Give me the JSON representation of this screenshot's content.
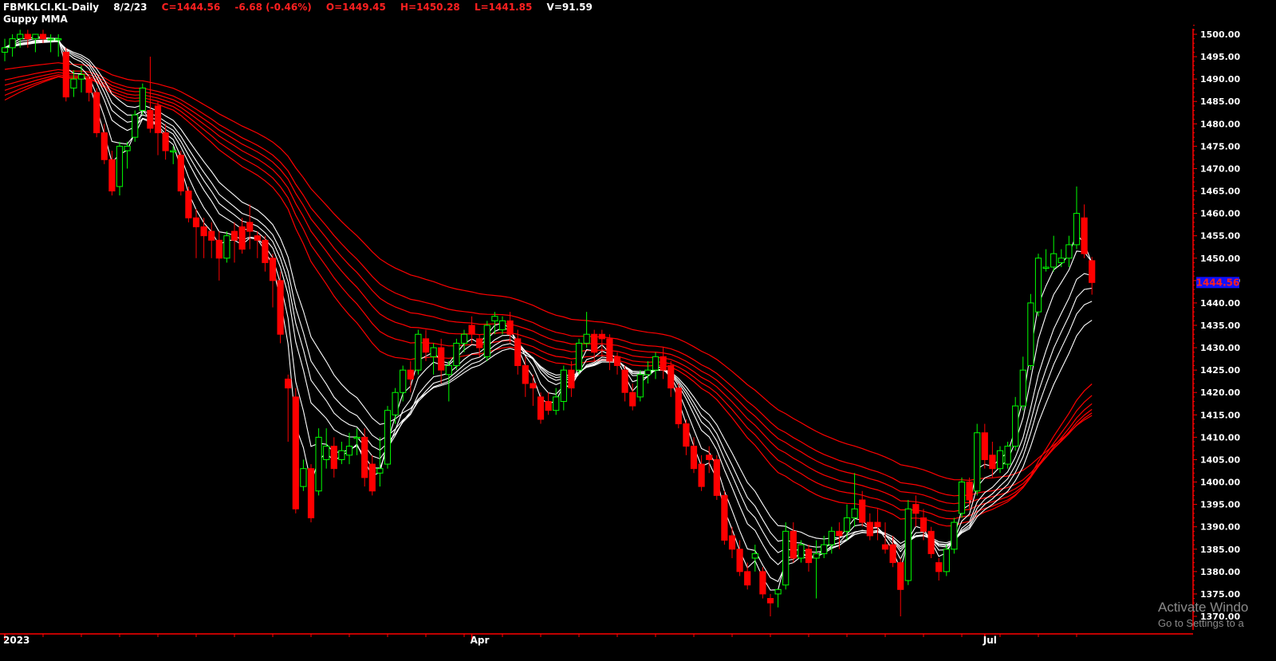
{
  "header": {
    "symbol": "FBMKLCI.KL",
    "period": "-Daily",
    "date": "8/2/23",
    "close": "C=1444.56",
    "change": "-6.68 (-0.46%)",
    "open": "O=1449.45",
    "high": "H=1450.28",
    "low": "L=1441.85",
    "volume": "V=91.59"
  },
  "indicator": {
    "label": "Guppy MMA"
  },
  "price_tag": {
    "text": "1444.56",
    "value": 1444.56,
    "bg": "#1010ff",
    "color": "#ff2020"
  },
  "watermark": {
    "line1": "Activate Windo",
    "line2": "Go to Settings to a"
  },
  "colors": {
    "background": "#000000",
    "bull": "#00ff00",
    "bear": "#ff0000",
    "short_mma": "#ffffff",
    "long_mma": "#ff0000",
    "axis": "#ff0000",
    "tick_label": "#ffffff"
  },
  "chart_data": {
    "type": "candlestick",
    "title": "FBMKLCI.KL -Daily 8/2/23",
    "ylim": [
      1369,
      1503
    ],
    "y_ticks": [
      1370,
      1375,
      1380,
      1385,
      1390,
      1395,
      1400,
      1405,
      1410,
      1415,
      1420,
      1425,
      1430,
      1435,
      1440,
      1445,
      1450,
      1455,
      1460,
      1465,
      1470,
      1475,
      1480,
      1485,
      1490,
      1495,
      1500
    ],
    "x_labels": [
      {
        "label": "2023",
        "index": 0
      },
      {
        "label": "Apr",
        "index": 61
      },
      {
        "label": "Jul",
        "index": 128
      }
    ],
    "candles": [
      [
        1496,
        1499,
        1494,
        1497
      ],
      [
        1497,
        1500,
        1495,
        1499
      ],
      [
        1499,
        1501,
        1497,
        1500
      ],
      [
        1500,
        1501,
        1497,
        1499
      ],
      [
        1499,
        1500,
        1496,
        1500
      ],
      [
        1500,
        1501,
        1498,
        1499
      ],
      [
        1499,
        1500,
        1496,
        1499
      ],
      [
        1499,
        1500,
        1495,
        1499
      ],
      [
        1496,
        1497,
        1485,
        1486
      ],
      [
        1488,
        1492,
        1486,
        1490
      ],
      [
        1490,
        1493,
        1487,
        1491
      ],
      [
        1490,
        1491,
        1485,
        1487
      ],
      [
        1487,
        1488,
        1477,
        1478
      ],
      [
        1478,
        1480,
        1471,
        1472
      ],
      [
        1472,
        1474,
        1464,
        1465
      ],
      [
        1466,
        1476,
        1464,
        1475
      ],
      [
        1474,
        1476,
        1470,
        1475
      ],
      [
        1477,
        1483,
        1476,
        1482
      ],
      [
        1483,
        1489,
        1482,
        1488
      ],
      [
        1483,
        1495,
        1478,
        1479
      ],
      [
        1484,
        1485,
        1473,
        1478
      ],
      [
        1478,
        1480,
        1472,
        1474
      ],
      [
        1474,
        1475,
        1471,
        1474
      ],
      [
        1473,
        1474,
        1464,
        1465
      ],
      [
        1465,
        1466,
        1458,
        1459
      ],
      [
        1459,
        1461,
        1450,
        1457
      ],
      [
        1457,
        1459,
        1450,
        1455
      ],
      [
        1456,
        1458,
        1450,
        1454
      ],
      [
        1454,
        1456,
        1445,
        1450
      ],
      [
        1450,
        1456,
        1449,
        1455
      ],
      [
        1456,
        1458,
        1449,
        1454
      ],
      [
        1457,
        1459,
        1451,
        1452
      ],
      [
        1458,
        1462,
        1452,
        1456
      ],
      [
        1455,
        1456,
        1450,
        1454
      ],
      [
        1454,
        1455,
        1447,
        1449
      ],
      [
        1450,
        1451,
        1439,
        1445
      ],
      [
        1445,
        1447,
        1431,
        1433
      ],
      [
        1423,
        1424,
        1409,
        1421
      ],
      [
        1419,
        1421,
        1393,
        1394
      ],
      [
        1399,
        1405,
        1398,
        1403
      ],
      [
        1403,
        1404,
        1391,
        1392
      ],
      [
        1398,
        1412,
        1397,
        1410
      ],
      [
        1405,
        1412,
        1403,
        1408
      ],
      [
        1408,
        1410,
        1401,
        1403
      ],
      [
        1405,
        1409,
        1404,
        1407
      ],
      [
        1406,
        1411,
        1404,
        1408
      ],
      [
        1410,
        1412,
        1406,
        1410
      ],
      [
        1410,
        1412,
        1399,
        1401
      ],
      [
        1404,
        1406,
        1397,
        1398
      ],
      [
        1402,
        1410,
        1399,
        1403
      ],
      [
        1404,
        1417,
        1403,
        1416
      ],
      [
        1415,
        1421,
        1413,
        1420
      ],
      [
        1420,
        1426,
        1418,
        1425
      ],
      [
        1425,
        1427,
        1420,
        1423
      ],
      [
        1425,
        1434,
        1424,
        1433
      ],
      [
        1432,
        1434,
        1427,
        1429
      ],
      [
        1428,
        1431,
        1424,
        1430
      ],
      [
        1430,
        1432,
        1422,
        1425
      ],
      [
        1424,
        1427,
        1418,
        1426
      ],
      [
        1426,
        1432,
        1425,
        1431
      ],
      [
        1431,
        1434,
        1429,
        1433
      ],
      [
        1435,
        1437,
        1431,
        1433
      ],
      [
        1432,
        1433,
        1428,
        1430
      ],
      [
        1428,
        1436,
        1427,
        1435
      ],
      [
        1436,
        1438,
        1433,
        1437
      ],
      [
        1434,
        1437,
        1433,
        1436
      ],
      [
        1436,
        1438,
        1431,
        1433
      ],
      [
        1432,
        1434,
        1424,
        1426
      ],
      [
        1426,
        1428,
        1419,
        1422
      ],
      [
        1422,
        1424,
        1417,
        1421
      ],
      [
        1419,
        1420,
        1413,
        1414
      ],
      [
        1418,
        1420,
        1415,
        1416
      ],
      [
        1416,
        1421,
        1415,
        1419
      ],
      [
        1418,
        1426,
        1416,
        1425
      ],
      [
        1425,
        1427,
        1419,
        1421
      ],
      [
        1425,
        1432,
        1424,
        1431
      ],
      [
        1431,
        1438,
        1430,
        1433
      ],
      [
        1433,
        1434,
        1427,
        1429
      ],
      [
        1433,
        1434,
        1428,
        1432
      ],
      [
        1432,
        1433,
        1425,
        1427
      ],
      [
        1428,
        1429,
        1424,
        1426
      ],
      [
        1425,
        1426,
        1418,
        1420
      ],
      [
        1420,
        1422,
        1416,
        1417
      ],
      [
        1419,
        1425,
        1418,
        1424
      ],
      [
        1424,
        1427,
        1422,
        1425
      ],
      [
        1425,
        1429,
        1423,
        1428
      ],
      [
        1428,
        1430,
        1423,
        1425
      ],
      [
        1426,
        1427,
        1419,
        1421
      ],
      [
        1421,
        1422,
        1412,
        1413
      ],
      [
        1413,
        1414,
        1406,
        1408
      ],
      [
        1408,
        1410,
        1402,
        1403
      ],
      [
        1404,
        1406,
        1398,
        1399
      ],
      [
        1406,
        1408,
        1402,
        1405
      ],
      [
        1405,
        1406,
        1396,
        1397
      ],
      [
        1397,
        1398,
        1386,
        1387
      ],
      [
        1388,
        1390,
        1383,
        1385
      ],
      [
        1385,
        1387,
        1379,
        1380
      ],
      [
        1380,
        1382,
        1376,
        1377
      ],
      [
        1383,
        1386,
        1380,
        1384
      ],
      [
        1380,
        1381,
        1374,
        1375
      ],
      [
        1374,
        1375,
        1370,
        1373
      ],
      [
        1375,
        1376,
        1372,
        1376
      ],
      [
        1377,
        1391,
        1376,
        1389
      ],
      [
        1389,
        1391,
        1382,
        1383
      ],
      [
        1383,
        1387,
        1382,
        1386
      ],
      [
        1385,
        1386,
        1380,
        1382
      ],
      [
        1383,
        1387,
        1374,
        1384
      ],
      [
        1384,
        1388,
        1383,
        1386
      ],
      [
        1386,
        1390,
        1384,
        1389
      ],
      [
        1389,
        1391,
        1385,
        1388
      ],
      [
        1389,
        1395,
        1387,
        1392
      ],
      [
        1392,
        1402,
        1390,
        1394
      ],
      [
        1396,
        1398,
        1390,
        1391
      ],
      [
        1391,
        1393,
        1387,
        1388
      ],
      [
        1391,
        1394,
        1387,
        1390
      ],
      [
        1386,
        1391,
        1384,
        1385
      ],
      [
        1386,
        1388,
        1381,
        1382
      ],
      [
        1382,
        1383,
        1370,
        1376
      ],
      [
        1378,
        1396,
        1377,
        1394
      ],
      [
        1395,
        1397,
        1390,
        1393
      ],
      [
        1392,
        1394,
        1387,
        1389
      ],
      [
        1389,
        1390,
        1383,
        1384
      ],
      [
        1382,
        1383,
        1378,
        1380
      ],
      [
        1380,
        1386,
        1379,
        1385
      ],
      [
        1385,
        1392,
        1384,
        1391
      ],
      [
        1393,
        1401,
        1392,
        1400
      ],
      [
        1400,
        1401,
        1394,
        1396
      ],
      [
        1398,
        1413,
        1397,
        1411
      ],
      [
        1411,
        1413,
        1403,
        1405
      ],
      [
        1406,
        1409,
        1401,
        1403
      ],
      [
        1403,
        1408,
        1402,
        1407
      ],
      [
        1404,
        1409,
        1403,
        1408
      ],
      [
        1408,
        1419,
        1407,
        1417
      ],
      [
        1417,
        1428,
        1416,
        1425
      ],
      [
        1426,
        1442,
        1425,
        1440
      ],
      [
        1438,
        1451,
        1437,
        1450
      ],
      [
        1448,
        1452,
        1447,
        1448
      ],
      [
        1448,
        1455,
        1447,
        1451
      ],
      [
        1449,
        1452,
        1448,
        1450
      ],
      [
        1450,
        1455,
        1448,
        1453
      ],
      [
        1453,
        1466,
        1452,
        1460
      ],
      [
        1459,
        1462,
        1450,
        1451
      ],
      [
        1449.45,
        1450.28,
        1441.85,
        1444.56
      ]
    ],
    "series_note": "Guppy multiple moving averages computed from closes",
    "short_periods": [
      3,
      5,
      8,
      10,
      12,
      15
    ],
    "long_periods": [
      30,
      35,
      40,
      45,
      50,
      60
    ]
  }
}
